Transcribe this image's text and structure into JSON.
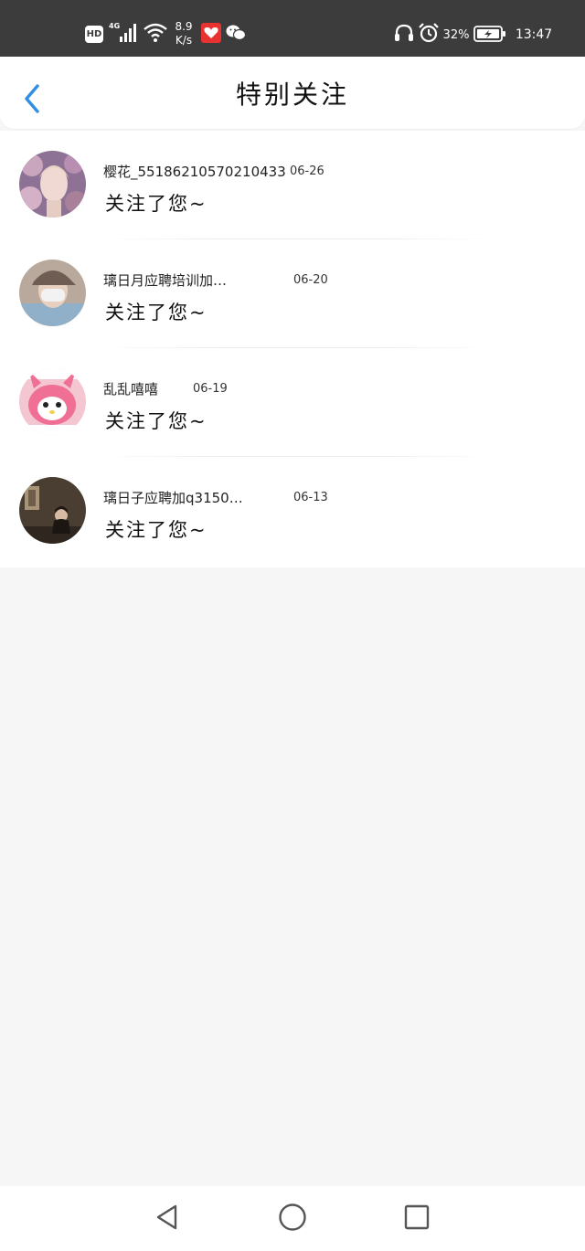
{
  "status_bar": {
    "hd": "HD",
    "network": "4G",
    "speed_value": "8.9",
    "speed_unit": "K/s",
    "battery_percent": "32%",
    "time": "13:47",
    "icons": [
      "hd-badge",
      "signal-4g-icon",
      "wifi-icon",
      "app-notification-icon",
      "wechat-icon",
      "headphone-icon",
      "alarm-icon",
      "battery-icon"
    ]
  },
  "header": {
    "title": "特别关注",
    "back_icon": "chevron-left-icon"
  },
  "list": {
    "items": [
      {
        "name": "樱花_5518621057021043 3",
        "display_name": "樱花_55186210570210433",
        "date": "06-26",
        "message": "关注了您~",
        "avatar": "avatar-flowers"
      },
      {
        "display_name": "璃日月应聘培训加…",
        "date": "06-20",
        "message": "关注了您~",
        "avatar": "avatar-cap-mask"
      },
      {
        "display_name": "乱乱嘻嘻",
        "date": "06-19",
        "message": "关注了您~",
        "avatar": "avatar-pink-character"
      },
      {
        "display_name": "璃日子应聘加q3150…",
        "date": "06-13",
        "message": "关注了您~",
        "avatar": "avatar-dark-room"
      }
    ]
  },
  "navbar": {
    "icons": [
      "back-triangle-icon",
      "home-circle-icon",
      "recents-square-icon"
    ]
  },
  "colors": {
    "accent": "#2f8fe5",
    "status_bar_bg": "#3c3c3c",
    "page_bg": "#f7f6f6"
  }
}
